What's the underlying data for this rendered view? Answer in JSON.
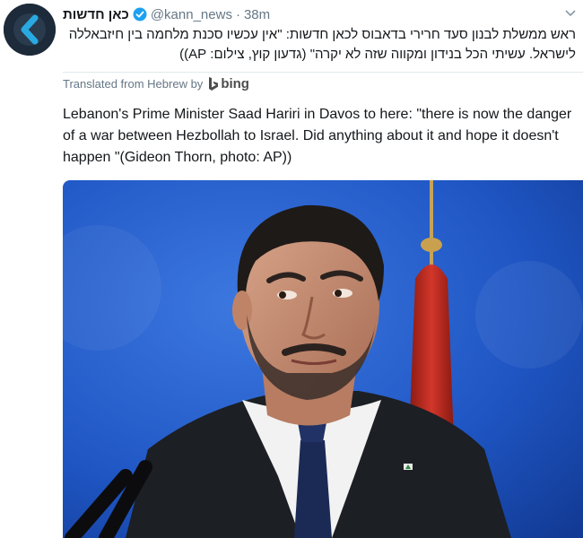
{
  "tweet": {
    "author_name": "כאן חדשות",
    "handle": "@kann_news",
    "separator": "·",
    "time": "38m",
    "text": "ראש ממשלת לבנון סעד חרירי בדאבוס לכאן חדשות: \"אין עכשיו סכנת מלחמה בין חיזבאללה לישראל. עשיתי הכל בנידון ומקווה שזה לא יקרה\" (גדעון קוץ, צילום: AP))",
    "translated_label": "Translated from Hebrew by",
    "translator": "bing",
    "translation": "Lebanon's Prime Minister Saad Hariri in Davos to here: \"there is now the danger of a war between Hezbollah to Israel. Did anything about it and hope it doesn't happen \"(Gideon Thorn, photo: AP))"
  },
  "icons": {
    "avatar": "kan-logo-icon",
    "verified": "verified-badge-icon",
    "menu": "chevron-down-icon",
    "bing": "bing-logo-icon"
  },
  "colors": {
    "verified": "#1da1f2",
    "secondary_text": "#657786",
    "avatar_bg": "#1c2a3a",
    "photo_background": "#1f4fb8"
  }
}
